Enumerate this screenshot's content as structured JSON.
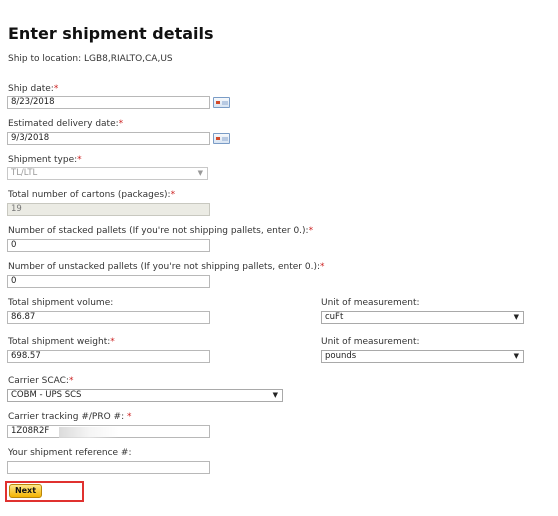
{
  "header": {
    "title": "Enter shipment details",
    "ship_to": "Ship to location: LGB8,RIALTO,CA,US"
  },
  "form": {
    "required_marker": "*",
    "ship_date": {
      "label": "Ship date:",
      "value": "8/23/2018"
    },
    "delivery_date": {
      "label": "Estimated delivery date:",
      "value": "9/3/2018"
    },
    "shipment_type": {
      "label": "Shipment type:",
      "value": "TL/LTL"
    },
    "cartons": {
      "label": "Total number of cartons (packages):",
      "value": "19"
    },
    "stacked_pallets": {
      "label": "Number of stacked pallets (If you're not shipping pallets, enter 0.):",
      "value": "0"
    },
    "unstacked_pallets": {
      "label": "Number of unstacked pallets (If you're not shipping pallets, enter 0.):",
      "value": "0"
    },
    "volume": {
      "label": "Total shipment volume:",
      "value": "86.87"
    },
    "volume_unit": {
      "label": "Unit of measurement:",
      "value": "cuFt"
    },
    "weight": {
      "label": "Total shipment weight:",
      "value": "698.57"
    },
    "weight_unit": {
      "label": "Unit of measurement:",
      "value": "pounds"
    },
    "carrier_scac": {
      "label": "Carrier SCAC:",
      "value": "COBM - UPS SCS"
    },
    "tracking": {
      "label": "Carrier tracking #/PRO #:",
      "value": "1Z08R2F"
    },
    "reference": {
      "label": "Your shipment reference #:",
      "value": ""
    }
  },
  "actions": {
    "next_label": "Next"
  },
  "icons": {
    "calendar": "calendar-icon",
    "dropdown": "chevron-down-icon"
  },
  "colors": {
    "required": "#cc2222",
    "button": "#f4b400",
    "highlight": "#e0312f"
  }
}
